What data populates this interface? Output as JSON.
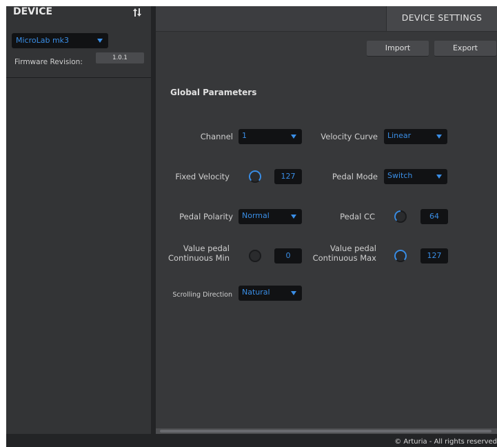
{
  "device_panel": {
    "title": "DEVICE",
    "sort_icon": "sort-arrows-icon",
    "device_select": {
      "value": "MicroLab mk3"
    },
    "firmware_label": "Firmware Revision:",
    "firmware_value": "1.0.1"
  },
  "settings_panel": {
    "tab_title": "DEVICE SETTINGS",
    "import_label": "Import",
    "export_label": "Export",
    "section_title": "Global Parameters",
    "params": {
      "channel": {
        "label": "Channel",
        "value": "1"
      },
      "velocity_curve": {
        "label": "Velocity Curve",
        "value": "Linear"
      },
      "fixed_velocity": {
        "label": "Fixed Velocity",
        "value": "127",
        "level": 1.0
      },
      "pedal_mode": {
        "label": "Pedal Mode",
        "value": "Switch"
      },
      "pedal_polarity": {
        "label": "Pedal Polarity",
        "value": "Normal"
      },
      "pedal_cc": {
        "label": "Pedal CC",
        "value": "64",
        "level": 0.5
      },
      "value_pedal_min": {
        "label_line1": "Value pedal",
        "label_line2": "Continuous Min",
        "value": "0",
        "level": 0.0
      },
      "value_pedal_max": {
        "label_line1": "Value pedal",
        "label_line2": "Continuous Max",
        "value": "127",
        "level": 1.0
      },
      "scrolling_direction": {
        "label": "Scrolling Direction",
        "value": "Natural"
      }
    }
  },
  "footer": {
    "copyright": "© Arturia - All rights reserved"
  },
  "colors": {
    "accent": "#3a8ee6",
    "panel": "#37383a",
    "sidebar": "#333436",
    "background": "#232426"
  }
}
